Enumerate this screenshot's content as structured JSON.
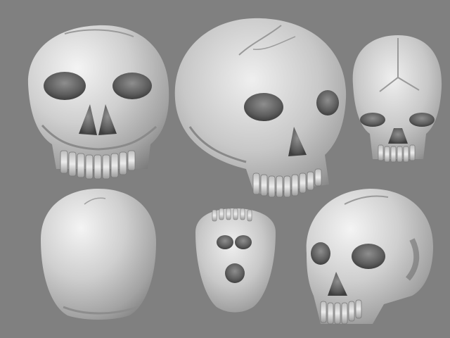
{
  "scene": {
    "background": "#808080",
    "skull_base_color": "#c9c9c9",
    "skull_highlight_color": "#f2f2f2",
    "skull_shadow_color": "#6e6e6e",
    "cavity_color": "#4a4a4a",
    "views": [
      {
        "id": "front",
        "icon": "skull-front-view"
      },
      {
        "id": "oblique-left",
        "icon": "skull-oblique-view"
      },
      {
        "id": "top-front",
        "icon": "skull-top-front-view"
      },
      {
        "id": "back",
        "icon": "skull-back-view"
      },
      {
        "id": "bottom",
        "icon": "skull-bottom-view"
      },
      {
        "id": "oblique-right",
        "icon": "skull-oblique-right-view"
      }
    ]
  }
}
